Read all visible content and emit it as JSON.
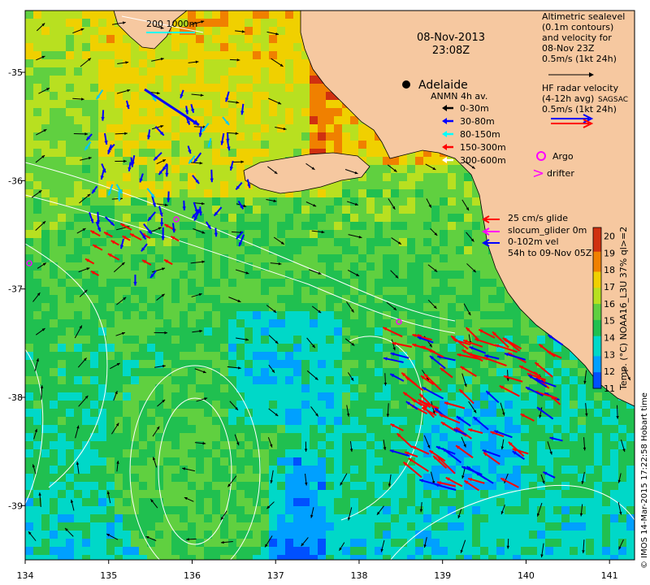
{
  "date_line": "08-Nov-2013",
  "time_line": "23:08Z",
  "scale_bar": "200  1000m",
  "place": "Adelaide",
  "sealevel_legend": [
    "Altimetric sealevel",
    "(0.1m contours)",
    "and velocity for",
    "08-Nov 23Z",
    "0.5m/s (1kt 24h)"
  ],
  "hf_legend": [
    "HF radar velocity",
    "(4-12h avg)",
    "0.5m/s (1kt 24h)"
  ],
  "hf_tag": "SAGSAC",
  "anmn_title": "ANMN 4h av.",
  "anmn_items": [
    {
      "label": "0-30m",
      "color": "#000000"
    },
    {
      "label": "30-80m",
      "color": "#0000ff"
    },
    {
      "label": "80-150m",
      "color": "#00ffff"
    },
    {
      "label": "150-300m",
      "color": "#ff0000"
    },
    {
      "label": "300-600m",
      "color": "#ffffff"
    }
  ],
  "argo_label": "Argo",
  "drifter_label": "drifter",
  "drifter_symbol": ">",
  "glider_legend": [
    "25 cm/s glide",
    "slocum_glider 0m",
    "0-102m vel",
    "54h to 09-Nov 05Z"
  ],
  "colorbar_title": "Temp. (°C) NOAA16_L3U 37% ql>=2",
  "colorbar_ticks": [
    "20",
    "19",
    "18",
    "17",
    "16",
    "15",
    "14",
    "13",
    "12",
    "11"
  ],
  "colorbar_range": [
    11,
    20.5
  ],
  "credit": "© IMOS 14-Mar-2015 17:22:58 Hobart time",
  "x_ticks": [
    "134",
    "135",
    "136",
    "137",
    "138",
    "139",
    "140",
    "141"
  ],
  "y_ticks": [
    "-35",
    "-36",
    "-37",
    "-38",
    "-39"
  ],
  "colors": {
    "land": "#f6c8a0",
    "argo": "#ff00ff",
    "drifter": "#ff00ff",
    "radar_red": "#ff0000",
    "radar_blue": "#0000ff"
  }
}
